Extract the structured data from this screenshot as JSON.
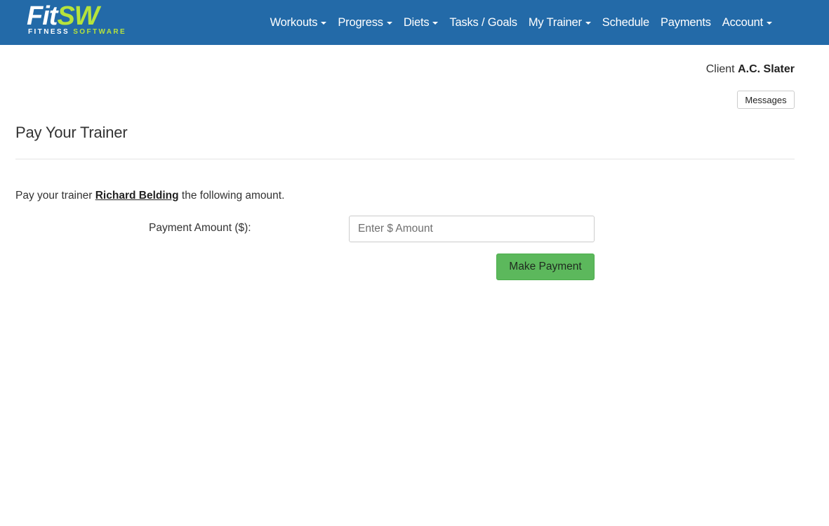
{
  "brand": {
    "logo_main_fit": "Fit",
    "logo_main_sw": "SW",
    "logo_sub_fit": "FITNESS",
    "logo_sub_sw": "SOFTWARE",
    "colors": {
      "navbar": "#236aa8",
      "logo_accent": "#b6e33c",
      "primary_button": "#5cb85c"
    }
  },
  "nav": {
    "items": [
      {
        "label": "Workouts",
        "has_dropdown": true
      },
      {
        "label": "Progress",
        "has_dropdown": true
      },
      {
        "label": "Diets",
        "has_dropdown": true
      },
      {
        "label": "Tasks / Goals",
        "has_dropdown": false
      },
      {
        "label": "My Trainer",
        "has_dropdown": true
      },
      {
        "label": "Schedule",
        "has_dropdown": false
      },
      {
        "label": "Payments",
        "has_dropdown": false
      },
      {
        "label": "Account",
        "has_dropdown": true
      }
    ]
  },
  "client": {
    "prefix": "Client",
    "name": "A.C. Slater"
  },
  "messages_button": {
    "label": "Messages"
  },
  "page": {
    "title": "Pay Your Trainer",
    "intro_before": "Pay your trainer",
    "trainer_name": "Richard Belding",
    "intro_after": "the following amount."
  },
  "form": {
    "amount_label": "Payment Amount ($):",
    "amount_placeholder": "Enter $ Amount",
    "amount_value": "",
    "submit_label": "Make Payment"
  }
}
